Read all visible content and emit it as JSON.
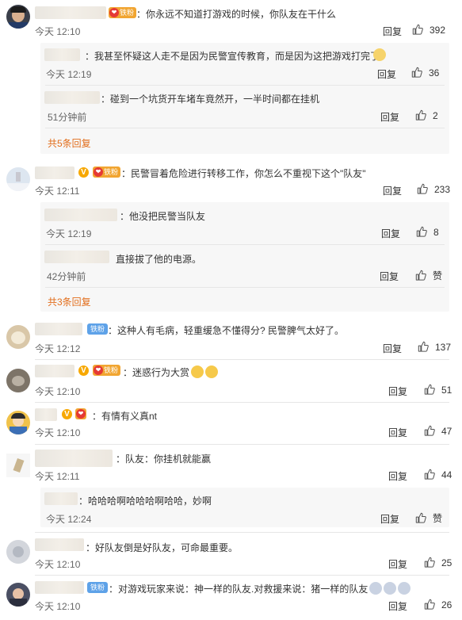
{
  "labels": {
    "reply": "回复",
    "zan": "赞"
  },
  "badges": {
    "tiefen": "铁粉",
    "v": "V"
  },
  "comments": [
    {
      "text": "：你永远不知道打游戏的时候，你队友在干什么",
      "time": "今天 12:10",
      "likes": "392",
      "replies": [
        {
          "text": "：我甚至怀疑这人走不是因为民警宣传教育，而是因为这把游戏打完了",
          "time": "今天 12:19",
          "likes": "36"
        },
        {
          "text": "：碰到一个坑货开车堵车竟然开，一半时间都在挂机",
          "time": "51分钟前",
          "likes": "2"
        }
      ],
      "more": "共5条回复"
    },
    {
      "text": "：民警冒着危险进行转移工作，你怎么不重视下这个\"队友\"",
      "time": "今天 12:11",
      "likes": "233",
      "replies": [
        {
          "text": "：他没把民警当队友",
          "time": "今天 12:19",
          "likes": "8"
        },
        {
          "text": "直接拔了他的电源。",
          "time": "42分钟前",
          "likes": "赞"
        }
      ],
      "more": "共3条回复"
    },
    {
      "text": "：这种人有毛病，轻重缓急不懂得分? 民警脾气太好了。",
      "time": "今天 12:12",
      "likes": "137"
    },
    {
      "text": "：迷惑行为大赏",
      "time": "今天 12:10",
      "likes": "51"
    },
    {
      "text": "：有情有义真nt",
      "time": "今天 12:10",
      "likes": "47"
    },
    {
      "text": "：队友：你挂机就能赢",
      "time": "今天 12:11",
      "likes": "44",
      "replies": [
        {
          "text": "：哈哈哈啊哈哈哈啊哈哈，妙啊",
          "time": "今天 12:24",
          "likes": "赞"
        }
      ]
    },
    {
      "text": "：好队友倒是好队友，可命最重要。",
      "time": "今天 12:10",
      "likes": "25"
    },
    {
      "text": "：对游戏玩家来说：神一样的队友.对救援来说：猪一样的队友",
      "time": "今天 12:10",
      "likes": "26"
    }
  ],
  "icon_names": [
    "thumbs-up-icon",
    "v-badge-icon",
    "fan-medal-icon",
    "emoji-icon"
  ],
  "colors": {
    "more_link": "#e26d1b",
    "fan_badge": "#f1a531",
    "blue_badge": "#5ea2e8",
    "v_badge": "#f7a800"
  }
}
